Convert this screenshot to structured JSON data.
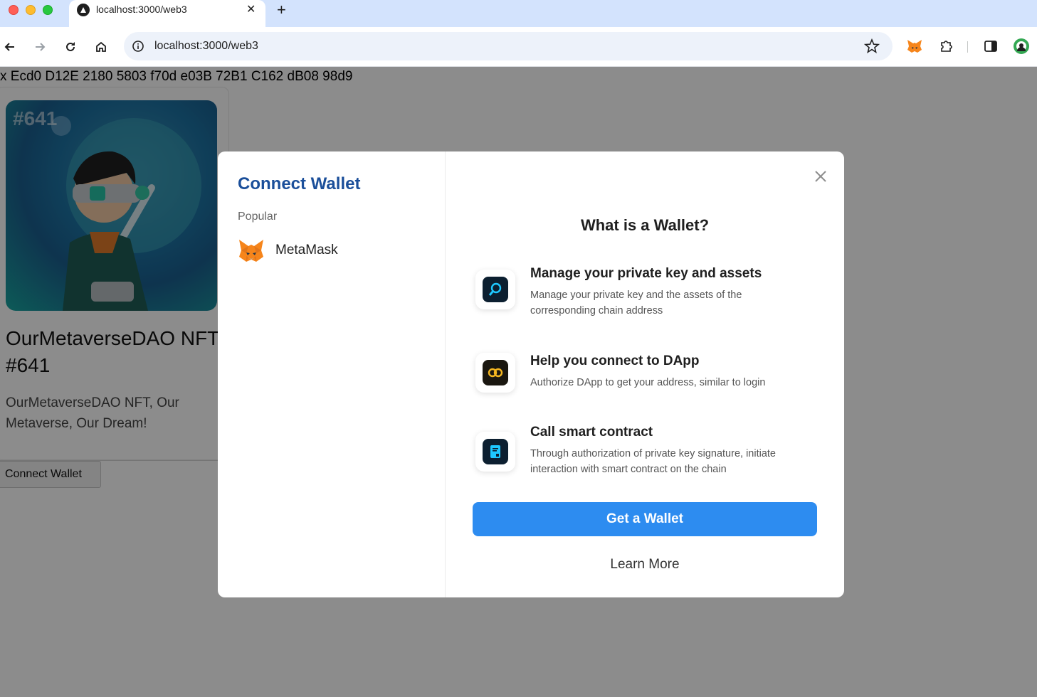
{
  "browser": {
    "tab_title": "localhost:3000/web3",
    "tab_close": "✕",
    "new_tab": "+",
    "url": "localhost:3000/web3"
  },
  "page": {
    "address_text": "x Ecd0 D12E 2180 5803 f70d e03B 72B1 C162 dB08 98d9",
    "nft": {
      "number_overlay": "#641",
      "title": "OurMetaverseDAO NFT #641",
      "description": "OurMetaverseDAO NFT, Our Metaverse, Our Dream!"
    },
    "connect_button": "Connect Wallet"
  },
  "modal": {
    "title": "Connect Wallet",
    "popular_label": "Popular",
    "wallets": [
      {
        "name": "MetaMask",
        "icon": "metamask-fox-icon"
      }
    ],
    "info_heading": "What is a Wallet?",
    "features": [
      {
        "icon": "key-search-icon",
        "title": "Manage your private key and assets",
        "description": "Manage your private key and the assets of the corresponding chain address"
      },
      {
        "icon": "link-icon",
        "title": "Help you connect to DApp",
        "description": "Authorize DApp to get your address, similar to login"
      },
      {
        "icon": "contract-icon",
        "title": "Call smart contract",
        "description": "Through authorization of private key signature, initiate interaction with smart contract on the chain"
      }
    ],
    "primary_button": "Get a Wallet",
    "secondary_link": "Learn More"
  },
  "colors": {
    "modal_title": "#1b4f9a",
    "primary_button": "#2d8cf0",
    "overlay": "rgba(0,0,0,0.45)"
  }
}
